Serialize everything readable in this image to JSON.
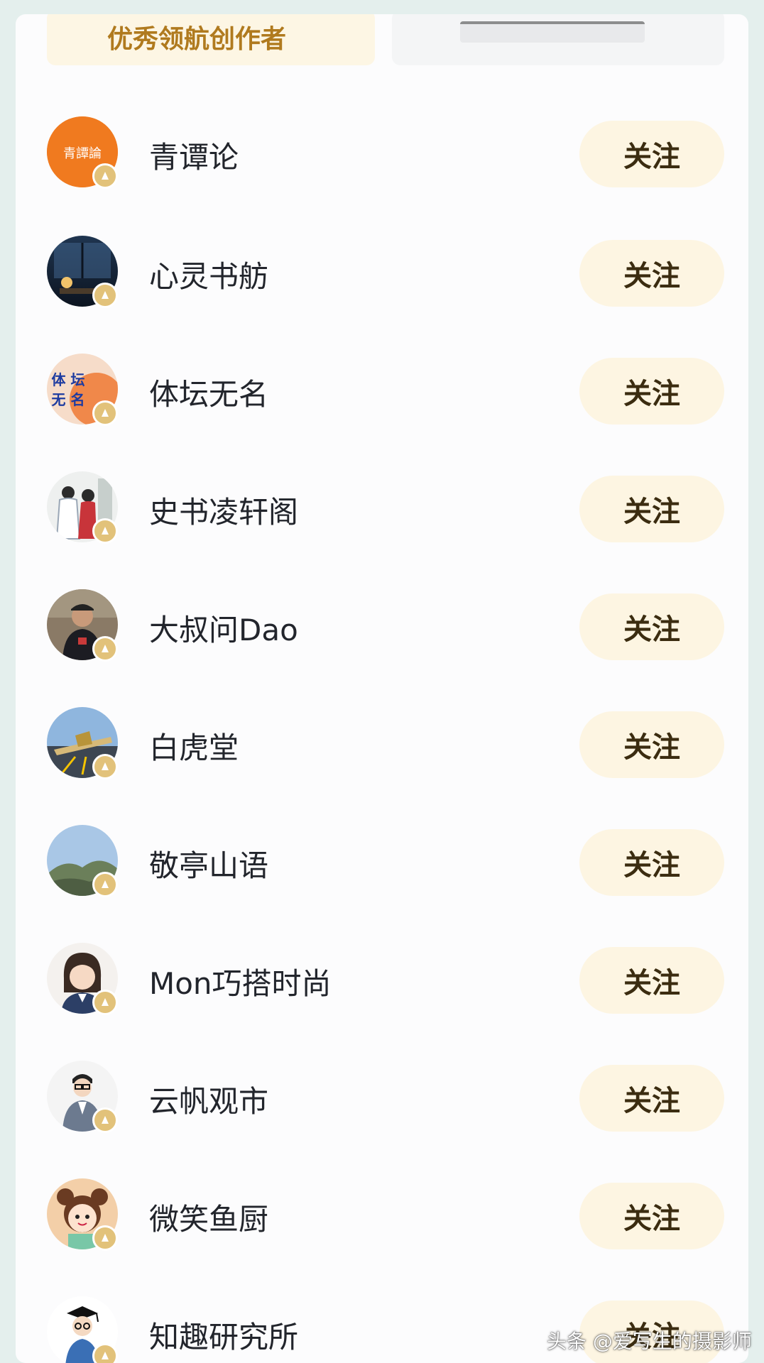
{
  "tabs": {
    "active_label": "优秀领航创作者"
  },
  "follow_label": "关注",
  "creators": [
    {
      "name": "青谭论"
    },
    {
      "name": "心灵书舫"
    },
    {
      "name": "体坛无名"
    },
    {
      "name": "史书凌轩阁"
    },
    {
      "name": "大叔问Dao"
    },
    {
      "name": "白虎堂"
    },
    {
      "name": "敬亭山语"
    },
    {
      "name": "Mon巧搭时尚"
    },
    {
      "name": "云帆观市"
    },
    {
      "name": "微笑鱼厨"
    },
    {
      "name": "知趣研究所"
    }
  ],
  "avatar_texts": {
    "qingtanlun": "青譚論",
    "tiyu_line1": "体 坛",
    "tiyu_line2": "无 名"
  },
  "watermark": "头条 @爱写生的摄影师",
  "colors": {
    "accent_gold": "#b07a1e",
    "follow_bg": "#fdf5e2",
    "badge": "#e2c27a"
  }
}
